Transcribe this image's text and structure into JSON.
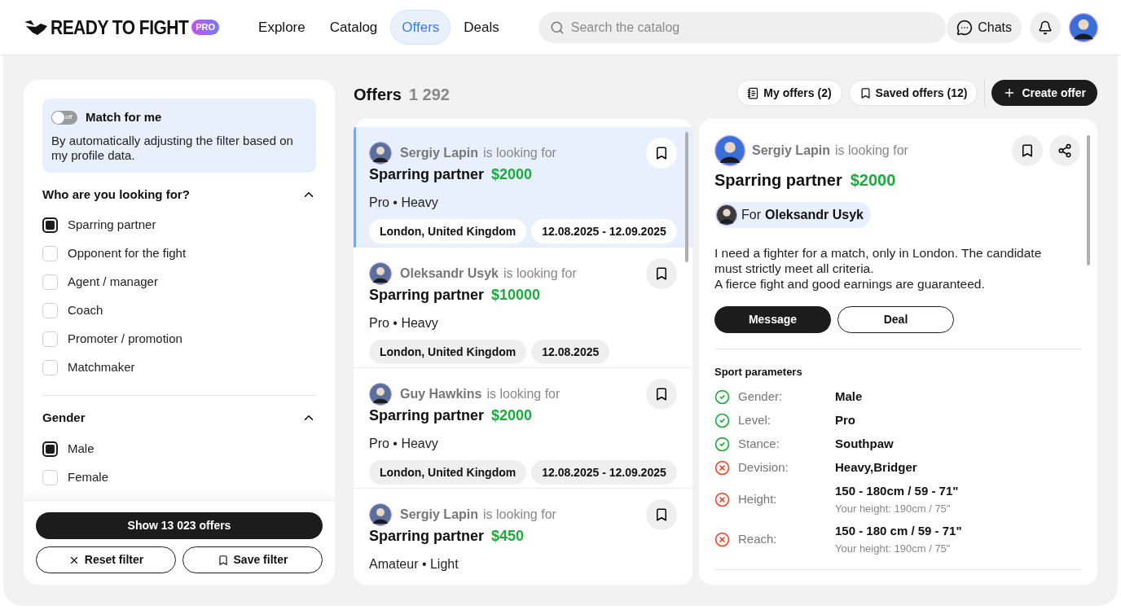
{
  "header": {
    "logo": {
      "text": "READY TO FIGHT",
      "badge": "PRO"
    },
    "nav": [
      {
        "label": "Explore",
        "selected": false
      },
      {
        "label": "Catalog",
        "selected": false
      },
      {
        "label": "Offers",
        "selected": true
      },
      {
        "label": "Deals",
        "selected": false
      }
    ],
    "search": {
      "placeholder": "Search the catalog"
    },
    "chats": "Chats"
  },
  "filter": {
    "match": {
      "on": false,
      "toggle_text": "off",
      "title": "Match for me",
      "description": "By automatically adjusting the filter based on my profile data."
    },
    "sections": [
      {
        "title": "Who are you looking for?",
        "expanded": true,
        "options": [
          {
            "label": "Sparring partner",
            "checked": true
          },
          {
            "label": "Opponent for the fight",
            "checked": false
          },
          {
            "label": "Agent / manager",
            "checked": false
          },
          {
            "label": "Coach",
            "checked": false
          },
          {
            "label": "Promoter / promotion",
            "checked": false
          },
          {
            "label": "Matchmaker",
            "checked": false
          }
        ]
      },
      {
        "title": "Gender",
        "expanded": true,
        "options": [
          {
            "label": "Male",
            "checked": true
          },
          {
            "label": "Female",
            "checked": false
          }
        ]
      }
    ],
    "show_button": "Show 13 023 offers",
    "reset_button": "Reset filter",
    "save_button": "Save filter"
  },
  "offers": {
    "title": "Offers",
    "count": "1 292",
    "actions": {
      "my_offers": "My offers (2)",
      "saved_offers": "Saved offers (12)",
      "create": "Create offer"
    },
    "items": [
      {
        "author": "Sergiy Lapin",
        "verb": "is looking for",
        "role": "Sparring partner",
        "price": "$2000",
        "meta": "Pro • Heavy",
        "tags": [
          "London, United Kingdom",
          "12.08.2025 - 12.09.2025"
        ],
        "selected": true
      },
      {
        "author": "Oleksandr Usyk",
        "verb": "is looking for",
        "role": "Sparring partner",
        "price": "$10000",
        "meta": "Pro • Heavy",
        "tags": [
          "London, United Kingdom",
          "12.08.2025"
        ],
        "selected": false
      },
      {
        "author": "Guy Hawkins",
        "verb": "is looking for",
        "role": "Sparring partner",
        "price": "$2000",
        "meta": "Pro • Heavy",
        "tags": [
          "London, United Kingdom",
          "12.08.2025 - 12.09.2025"
        ],
        "selected": false
      },
      {
        "author": "Sergiy Lapin",
        "verb": "is looking for",
        "role": "Sparring partner",
        "price": "$450",
        "meta": "Amateur • Light",
        "selected": false
      }
    ]
  },
  "detail": {
    "author": "Sergiy Lapin",
    "verb": "is looking for",
    "role": "Sparring partner",
    "price": "$2000",
    "for_label": "For",
    "for_name": "Oleksandr Usyk",
    "description": [
      "I need a fighter for a match, only in London. The candidate must strictly meet all criteria.",
      "A fierce fight and good earnings are guaranteed."
    ],
    "message_button": "Message",
    "deal_button": "Deal",
    "params_title": "Sport parameters",
    "params": [
      {
        "label": "Gender:",
        "value": "Male",
        "match": true
      },
      {
        "label": "Level:",
        "value": "Pro",
        "match": true
      },
      {
        "label": "Stance:",
        "value": "Southpaw",
        "match": true
      },
      {
        "label": "Devision:",
        "value": "Heavy,Bridger",
        "match": false
      },
      {
        "label": "Height:",
        "value": "150 - 180cm / 59 - 71\"",
        "note": "Your height: 190cm / 75\"",
        "match": false
      },
      {
        "label": "Reach:",
        "value": "150 - 180 cm / 59 - 71\"",
        "note": "Your height: 190cm / 75\"",
        "match": false
      }
    ]
  }
}
